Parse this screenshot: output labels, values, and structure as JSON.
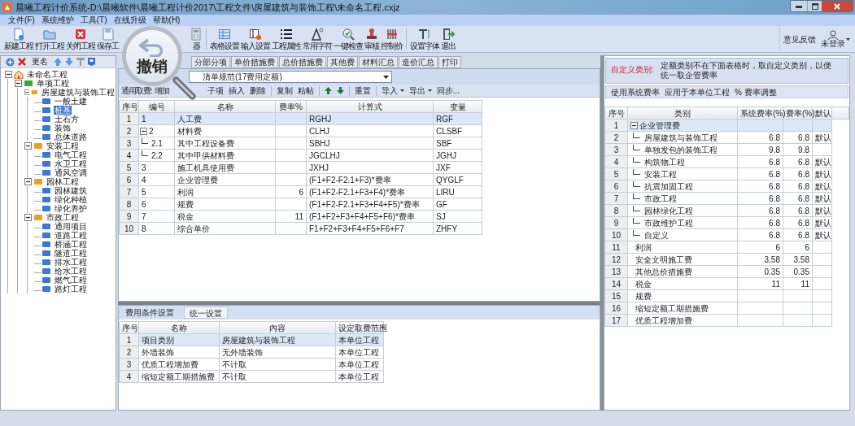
{
  "window": {
    "title": "晨曦工程计价系统-D:\\晨曦软件\\晨曦工程计价2017\\工程文件\\房屋建筑与装饰工程\\未命名工程.cxjz"
  },
  "menu": [
    "文件(F)",
    "系统维护",
    "工具(T)",
    "在线升级",
    "帮助(H)"
  ],
  "toolbar": {
    "buttons": [
      {
        "label": "新建工程",
        "kind": "new"
      },
      {
        "label": "打开工程",
        "kind": "open"
      },
      {
        "label": "关闭工程",
        "kind": "close"
      },
      {
        "label": "保存工",
        "kind": "save"
      },
      {
        "label": "器",
        "kind": "calc"
      },
      {
        "label": "表格设置",
        "kind": "table"
      },
      {
        "label": "输入设置",
        "kind": "input"
      },
      {
        "label": "工程属性",
        "kind": "props"
      },
      {
        "label": "常用字符",
        "kind": "chars"
      },
      {
        "label": "一键检查",
        "kind": "check"
      },
      {
        "label": "审核",
        "kind": "audit"
      },
      {
        "label": "控制价",
        "kind": "control"
      },
      {
        "label": "设置字体",
        "kind": "font"
      },
      {
        "label": "退出",
        "kind": "exit"
      }
    ],
    "feedback": "意见反馈",
    "user": "未登录"
  },
  "magnifier": {
    "label": "撤销"
  },
  "tree": {
    "rename": "更名",
    "root": {
      "label": "未命名工程",
      "selected": false,
      "expanded": true,
      "children": [
        {
          "label": "单项工程",
          "selected": false,
          "expanded": true,
          "children": [
            {
              "label": "房屋建筑与装饰工程",
              "selected": false,
              "expanded": true,
              "children": [
                {
                  "label": "一般土建",
                  "selected": false
                },
                {
                  "label": "桩基",
                  "selected": true
                },
                {
                  "label": "土石方",
                  "selected": false
                },
                {
                  "label": "装饰",
                  "selected": false
                },
                {
                  "label": "总体道路",
                  "selected": false
                }
              ]
            },
            {
              "label": "安装工程",
              "selected": false,
              "expanded": true,
              "children": [
                {
                  "label": "电气工程",
                  "selected": false
                },
                {
                  "label": "水卫工程",
                  "selected": false
                },
                {
                  "label": "通风空调",
                  "selected": false
                }
              ]
            },
            {
              "label": "园林工程",
              "selected": false,
              "expanded": true,
              "children": [
                {
                  "label": "园林建筑",
                  "selected": false
                },
                {
                  "label": "绿化种植",
                  "selected": false
                },
                {
                  "label": "绿化养护",
                  "selected": false
                }
              ]
            },
            {
              "label": "市政工程",
              "selected": false,
              "expanded": true,
              "children": [
                {
                  "label": "通用项目",
                  "selected": false
                },
                {
                  "label": "道路工程",
                  "selected": false
                },
                {
                  "label": "桥涵工程",
                  "selected": false
                },
                {
                  "label": "隧道工程",
                  "selected": false
                },
                {
                  "label": "排水工程",
                  "selected": false
                },
                {
                  "label": "给水工程",
                  "selected": false
                },
                {
                  "label": "燃气工程",
                  "selected": false
                },
                {
                  "label": "路灯工程",
                  "selected": false
                }
              ]
            }
          ]
        }
      ]
    }
  },
  "tabs": [
    {
      "label": "分部分项",
      "selected": false
    },
    {
      "label": "单价措施费",
      "selected": false
    },
    {
      "label": "总价措施费",
      "selected": false
    },
    {
      "label": "其他费",
      "selected": false
    },
    {
      "label": "材料汇总",
      "selected": false
    },
    {
      "label": "造价汇总",
      "selected": false
    },
    {
      "label": "打印",
      "selected": false
    }
  ],
  "standard_dropdown": {
    "value": "清单规范(17费用定额)"
  },
  "fee_toolbar": {
    "label": "通用取费:",
    "groups": [
      [
        {
          "label": "增加",
          "kind": "text"
        },
        {
          "label": "子项",
          "kind": "text"
        },
        {
          "label": "插入",
          "kind": "text"
        },
        {
          "label": "删除",
          "kind": "text"
        }
      ],
      [
        {
          "label": "复制",
          "kind": "text"
        },
        {
          "label": "粘帖",
          "kind": "text"
        }
      ],
      [
        {
          "kind": "up"
        },
        {
          "kind": "down"
        }
      ],
      [
        {
          "label": "重置",
          "kind": "text"
        }
      ],
      [
        {
          "label": "导入",
          "kind": "menu"
        },
        {
          "label": "导出",
          "kind": "menu"
        },
        {
          "label": "同步...",
          "kind": "text"
        }
      ]
    ]
  },
  "fee_table": {
    "columns": [
      "序号",
      "编号",
      "名称",
      "费率%",
      "计算式",
      "变量"
    ],
    "rows": [
      {
        "seq": "1",
        "code": "1",
        "name": "人工费",
        "formula": "RGHJ",
        "variable": "RGF",
        "selected": true
      },
      {
        "seq": "2",
        "code": "2",
        "name": "材料费",
        "formula": "CLHJ",
        "variable": "CLSBF",
        "selected": false,
        "expanded": true,
        "children": [
          {
            "seq": "3",
            "code": "2.1",
            "name": "其中工程设备费",
            "formula": "SBHJ",
            "variable": "SBF",
            "selected": false
          },
          {
            "seq": "4",
            "code": "2.2",
            "name": "其中甲供材料费",
            "formula": "JGCLHJ",
            "variable": "JGHJ",
            "selected": false
          }
        ]
      },
      {
        "seq": "5",
        "code": "3",
        "name": "施工机具使用费",
        "formula": "JXHJ",
        "variable": "JXF",
        "selected": false
      },
      {
        "seq": "6",
        "code": "4",
        "name": "企业管理费",
        "formula": "(F1+F2-F2.1+F3)*费率",
        "variable": "QYGLF",
        "selected": false
      },
      {
        "seq": "7",
        "code": "5",
        "name": "利润",
        "rate": "6",
        "formula": "(F1+F2-F2.1+F3+F4)*费率",
        "variable": "LIRU",
        "selected": false
      },
      {
        "seq": "8",
        "code": "6",
        "name": "规费",
        "formula": "(F1+F2-F2.1+F3+F4+F5)*费率",
        "variable": "GF",
        "selected": false
      },
      {
        "seq": "9",
        "code": "7",
        "name": "税金",
        "rate": "11",
        "formula": "(F1+F2+F3+F4+F5+F6)*费率",
        "variable": "SJ",
        "selected": false
      },
      {
        "seq": "10",
        "code": "8",
        "name": "综合单价",
        "formula": "F1+F2+F3+F4+F5+F6+F7",
        "variable": "ZHFY",
        "selected": false
      }
    ]
  },
  "condition_tabs": [
    {
      "label": "费用条件设置",
      "selected": false
    },
    {
      "label": "统一设置",
      "selected": true
    }
  ],
  "condition_table": {
    "columns": [
      "序号",
      "名称",
      "内容",
      "设定取费范围"
    ],
    "rows": [
      {
        "seq": "1",
        "name": "项目类别",
        "content": "房屋建筑与装饰工程",
        "scope": "本单位工程",
        "selected": true
      },
      {
        "seq": "2",
        "name": "外墙装饰",
        "content": "无外墙装饰",
        "scope": "本单位工程",
        "selected": false
      },
      {
        "seq": "3",
        "name": "优质工程增加费",
        "content": "不计取",
        "scope": "本单位工程",
        "selected": false
      },
      {
        "seq": "4",
        "name": "缩短定额工期措施费",
        "content": "不计取",
        "scope": "本单位工程",
        "selected": false
      }
    ]
  },
  "custom_note": {
    "label": "自定义类别:",
    "text": "定额类别不在下面表格时，取自定义类别，以便统一取企管费率"
  },
  "rate_buttons": [
    "使用系统费率",
    "应用于本单位工程",
    "% 费率调整"
  ],
  "rate_table": {
    "columns": [
      "序号",
      "类别",
      "系统费率(%)",
      "费率(%)",
      "默认"
    ],
    "rows": [
      {
        "seq": "1",
        "category": "企业管理费",
        "selected": true,
        "expanded": true,
        "children": [
          {
            "seq": "2",
            "category": "房屋建筑与装饰工程",
            "system_rate": "6.8",
            "rate": "6.8",
            "default": "默认",
            "selected": false
          },
          {
            "seq": "3",
            "category": "单独发包的装饰工程",
            "system_rate": "9.8",
            "rate": "9.8",
            "selected": false
          },
          {
            "seq": "4",
            "category": "构筑物工程",
            "system_rate": "6.8",
            "rate": "6.8",
            "default": "默认",
            "selected": false
          },
          {
            "seq": "5",
            "category": "安装工程",
            "system_rate": "6.8",
            "rate": "6.8",
            "default": "默认",
            "selected": false
          },
          {
            "seq": "6",
            "category": "抗震加固工程",
            "system_rate": "6.8",
            "rate": "6.8",
            "default": "默认",
            "selected": false
          },
          {
            "seq": "7",
            "category": "市政工程",
            "system_rate": "6.8",
            "rate": "6.8",
            "default": "默认",
            "selected": false
          },
          {
            "seq": "8",
            "category": "园林绿化工程",
            "system_rate": "6.8",
            "rate": "6.8",
            "default": "默认",
            "selected": false
          },
          {
            "seq": "9",
            "category": "市政维护工程",
            "system_rate": "6.8",
            "rate": "6.8",
            "default": "默认",
            "selected": false
          },
          {
            "seq": "10",
            "category": "自定义",
            "system_rate": "6.8",
            "rate": "6.8",
            "default": "默认",
            "selected": false
          }
        ]
      },
      {
        "seq": "11",
        "category": "利润",
        "system_rate": "6",
        "rate": "6",
        "selected": false
      },
      {
        "seq": "12",
        "category": "安全文明施工费",
        "system_rate": "3.58",
        "rate": "3.58",
        "selected": false
      },
      {
        "seq": "13",
        "category": "其他总价措施费",
        "system_rate": "0.35",
        "rate": "0.35",
        "selected": false
      },
      {
        "seq": "14",
        "category": "税金",
        "system_rate": "11",
        "rate": "11",
        "selected": false
      },
      {
        "seq": "15",
        "category": "规费",
        "selected": false
      },
      {
        "seq": "16",
        "category": "缩短定额工期措施费",
        "selected": false
      },
      {
        "seq": "17",
        "category": "优质工程增加费",
        "selected": false
      }
    ]
  }
}
